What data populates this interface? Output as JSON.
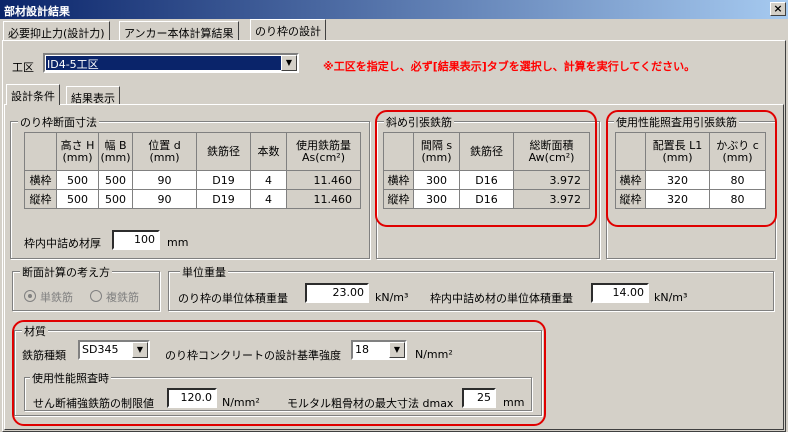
{
  "window": {
    "title": "部材設計結果",
    "close": "×"
  },
  "top_tabs": [
    "必要抑止力(設計力)",
    "アンカー本体計算結果",
    "のり枠の設計"
  ],
  "koku": {
    "label": "工区",
    "value": "ID4-5工区",
    "notice": "※工区を指定し、必ず[結果表示]タブを選択し、計算を実行してください。"
  },
  "sub_tabs": [
    "設計条件",
    "結果表示"
  ],
  "frame_section": {
    "title": "のり枠断面寸法",
    "headers": [
      "高さ H\n(mm)",
      "幅 B\n(mm)",
      "位置 d\n(mm)",
      "鉄筋径",
      "本数",
      "使用鉄筋量\nAs(cm²)"
    ],
    "rows": [
      {
        "label": "横枠",
        "cells": [
          "500",
          "500",
          "90",
          "D19",
          "4",
          "11.460"
        ]
      },
      {
        "label": "縦枠",
        "cells": [
          "500",
          "500",
          "90",
          "D19",
          "4",
          "11.460"
        ]
      }
    ],
    "fill_label": "枠内中詰め材厚",
    "fill_value": "100",
    "fill_unit": "mm"
  },
  "diagonal": {
    "title": "斜め引張鉄筋",
    "headers": [
      "間隔 s\n(mm)",
      "鉄筋径",
      "総断面積\nAw(cm²)"
    ],
    "rows": [
      {
        "label": "横枠",
        "cells": [
          "300",
          "D16",
          "3.972"
        ]
      },
      {
        "label": "縦枠",
        "cells": [
          "300",
          "D16",
          "3.972"
        ]
      }
    ]
  },
  "service_rebar": {
    "title": "使用性能照査用引張鉄筋",
    "headers": [
      "配置長 L1\n(mm)",
      "かぶり c\n(mm)"
    ],
    "rows": [
      {
        "label": "横枠",
        "cells": [
          "320",
          "80"
        ]
      },
      {
        "label": "縦枠",
        "cells": [
          "320",
          "80"
        ]
      }
    ]
  },
  "calc_method": {
    "title": "断面計算の考え方",
    "options": [
      "単鉄筋",
      "複鉄筋"
    ],
    "selected": "単鉄筋"
  },
  "unit_weight": {
    "title": "単位重量",
    "frame_label": "のり枠の単位体積重量",
    "frame_value": "23.00",
    "fill_label": "枠内中詰め材の単位体積重量",
    "fill_value": "14.00",
    "unit": "kN/m³"
  },
  "material": {
    "title": "材質",
    "rebar_label": "鉄筋種類",
    "rebar_value": "SD345",
    "concrete_label": "のり枠コンクリートの設計基準強度",
    "concrete_value": "18",
    "concrete_unit": "N/mm²",
    "service": {
      "title": "使用性能照査時",
      "shear_label": "せん断補強鉄筋の制限値",
      "shear_value": "120.0",
      "shear_unit": "N/mm²",
      "dmax_label": "モルタル粗骨材の最大寸法 dmax",
      "dmax_value": "25",
      "dmax_unit": "mm"
    }
  },
  "colors": {
    "titlebar": "#0a246a",
    "notice": "#ff0000",
    "highlight": "#e00000",
    "selection": "#0a246a"
  }
}
